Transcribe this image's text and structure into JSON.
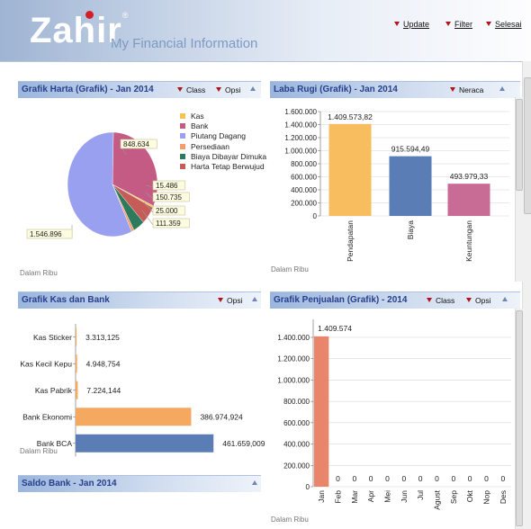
{
  "app": {
    "logo": "Zahir",
    "registered": "®",
    "tagline": "My Financial Information"
  },
  "top_menu": [
    {
      "label": "Update"
    },
    {
      "label": "Filter"
    },
    {
      "label": "Selesai"
    }
  ],
  "panels": {
    "harta": {
      "title": "Grafik Harta (Grafik) - Jan 2014",
      "menus": [
        "Class",
        "Opsi"
      ],
      "note": "Dalam Ribu",
      "chart_data": {
        "type": "pie",
        "categories": [
          "Kas",
          "Bank",
          "Piutang Dagang",
          "Persediaan",
          "Biaya Dibayar Dimuka",
          "Harta Tetap Berwujud"
        ],
        "values": [
          15486,
          848634,
          1546896,
          25000,
          111359,
          150735
        ],
        "labels": [
          "15.486",
          "848.634",
          "1.546.896",
          "25.000",
          "111.359",
          "150.735"
        ],
        "colors": [
          "#f4c451",
          "#c45b84",
          "#9aa0f0",
          "#f29d6b",
          "#2f7a5c",
          "#c65c58"
        ]
      }
    },
    "labarugi": {
      "title": "Laba Rugi (Grafik) - Jan 2014",
      "menus": [
        "Neraca"
      ],
      "note": "Dalam Ribu",
      "chart_data": {
        "type": "bar",
        "categories": [
          "Pendapatan",
          "Biaya",
          "Keuntungan"
        ],
        "values": [
          1409573.82,
          915594.49,
          493979.33
        ],
        "labels": [
          "1.409.573,82",
          "915.594,49",
          "493.979,33"
        ],
        "colors": [
          "#f8bd5e",
          "#5a7db6",
          "#c86b95"
        ],
        "yticks": [
          "0",
          "200.000",
          "400.000",
          "600.000",
          "800.000",
          "1.000.000",
          "1.200.000",
          "1.400.000",
          "1.600.000"
        ],
        "ylim": [
          0,
          1600000
        ]
      }
    },
    "kasbank": {
      "title": "Grafik Kas dan Bank",
      "menus": [
        "Opsi"
      ],
      "note": "Dalam Ribu",
      "chart_data": {
        "type": "bar",
        "orientation": "horizontal",
        "categories": [
          "Kas Sticker",
          "Kas Kecil Kepu",
          "Kas Pabrik",
          "Bank Ekonomi",
          "Bank BCA"
        ],
        "values": [
          3313.125,
          4948.754,
          7224.144,
          386974.924,
          461659.009
        ],
        "labels": [
          "3.313,125",
          "4.948,754",
          "7.224,144",
          "386.974,924",
          "461.659,009"
        ],
        "colors": [
          "#f4a860",
          "#f4a860",
          "#f4a860",
          "#f4a860",
          "#5a7db6"
        ],
        "xlim": [
          0,
          470000
        ]
      }
    },
    "saldo": {
      "title": "Saldo Bank - Jan 2014"
    },
    "penjualan": {
      "title": "Grafik Penjualan (Grafik) - 2014",
      "menus": [
        "Class",
        "Opsi"
      ],
      "note": "Dalam Ribu",
      "chart_data": {
        "type": "bar",
        "categories": [
          "Jan",
          "Feb",
          "Mar",
          "Apr",
          "Mei",
          "Jun",
          "Jul",
          "Agust",
          "Sep",
          "Okt",
          "Nop",
          "Des"
        ],
        "values": [
          1409574,
          0,
          0,
          0,
          0,
          0,
          0,
          0,
          0,
          0,
          0,
          0
        ],
        "labels": [
          "1.409.574",
          "0",
          "0",
          "0",
          "0",
          "0",
          "0",
          "0",
          "0",
          "0",
          "0",
          "0"
        ],
        "color": "#e8856a",
        "yticks": [
          "0",
          "200.000",
          "400.000",
          "600.000",
          "800.000",
          "1.000.000",
          "1.200.000",
          "1.400.000"
        ],
        "ylim": [
          0,
          1400000
        ]
      }
    }
  }
}
